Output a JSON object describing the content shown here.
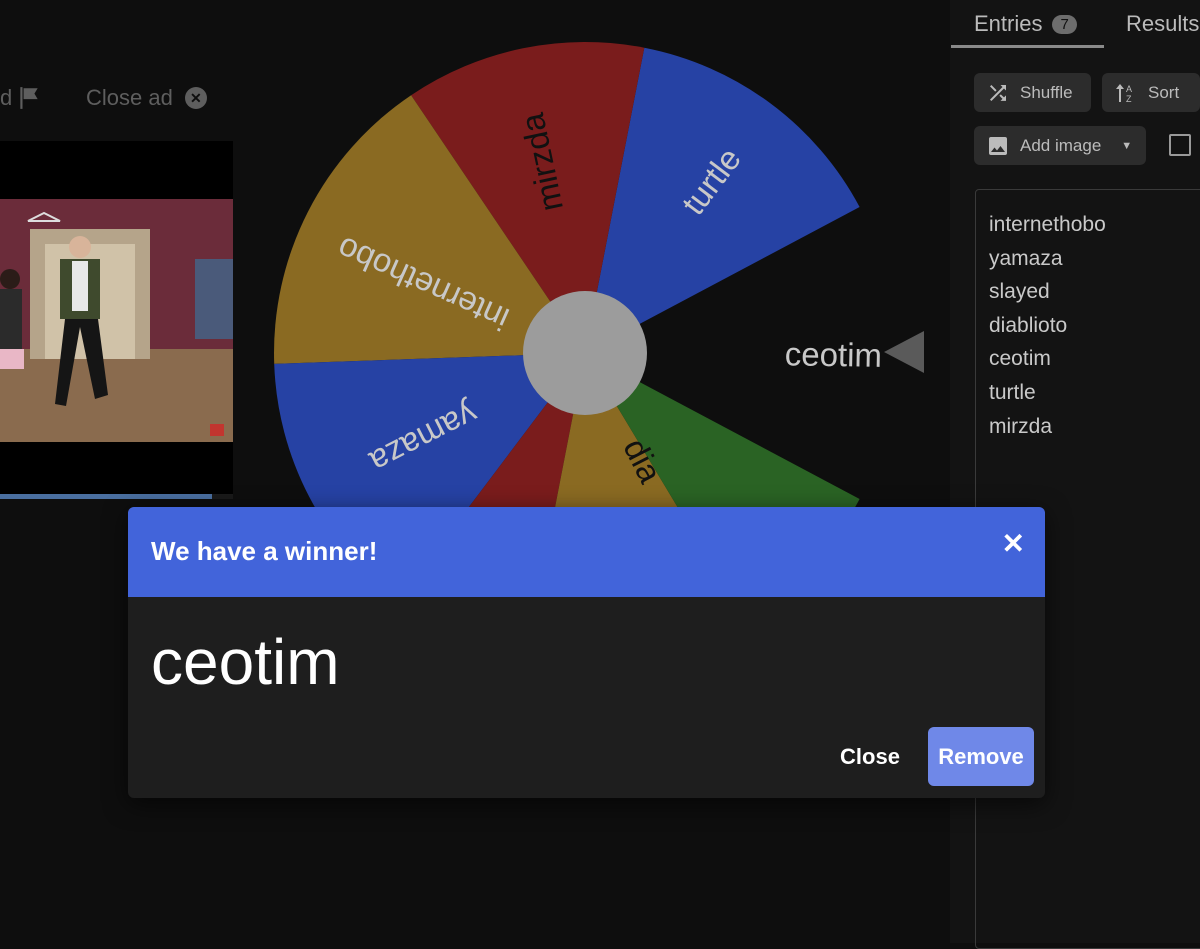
{
  "ad": {
    "report_text": "d",
    "close_text": "Close ad",
    "progress_fraction": 0.91
  },
  "wheel": {
    "segments": [
      {
        "label": "ceotim",
        "color": "#2642a4"
      },
      {
        "label": "turtle",
        "color": "#7a1c1c"
      },
      {
        "label": "mirzda",
        "color": "#8a6a22"
      },
      {
        "label": "internethobo",
        "color": "#2642a4"
      },
      {
        "label": "yamaza",
        "color": "#7a1c1c"
      },
      {
        "label": "",
        "color": "#8a6a22"
      },
      {
        "label": "diablioto",
        "color": "#2a6324"
      }
    ],
    "visible_labels": {
      "ceotim": "ceotim",
      "turtle": "turtle",
      "mirzda": "mirzda",
      "internethobo": "internethobo",
      "yamaza": "yamaza",
      "diablioto_partial": "dia"
    },
    "hub_color": "#9c9c9c",
    "label_color_light": "#c8c8c8",
    "label_color_dark": "#111111"
  },
  "sidebar": {
    "tabs": [
      {
        "label": "Entries",
        "count": "7"
      },
      {
        "label": "Results"
      }
    ],
    "shuffle_label": "Shuffle",
    "sort_label": "Sort",
    "add_image_label": "Add image",
    "entries": [
      "internethobo",
      "yamaza",
      "slayed",
      "diablioto",
      "ceotim",
      "turtle",
      "mirzda"
    ]
  },
  "modal": {
    "title": "We have a winner!",
    "winner": "ceotim",
    "close_label": "Close",
    "remove_label": "Remove",
    "header_color": "#4264da"
  }
}
